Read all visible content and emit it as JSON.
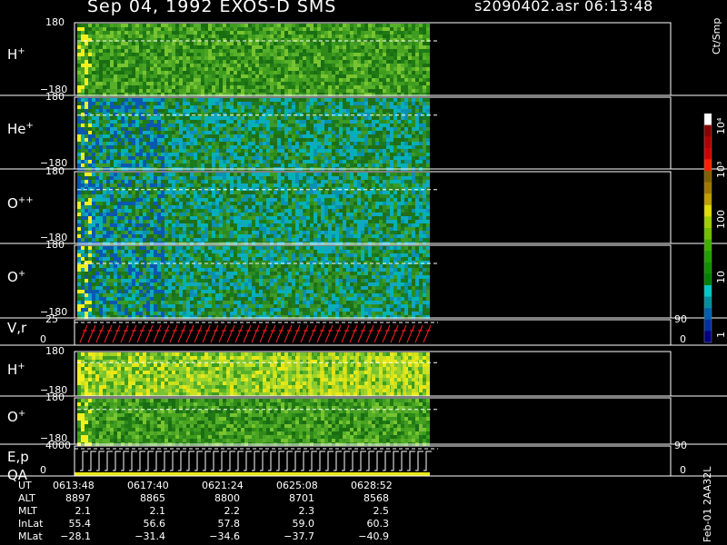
{
  "header": {
    "title": "Sep 04, 1992    EXOS-D SMS",
    "file_info": "s2090402.asr  06:13:48"
  },
  "panels": [
    {
      "id": "h-plus",
      "label": "H",
      "sup": "+",
      "ymax": "180",
      "ymin": "−180",
      "kind": "spectrogram",
      "palette": "green"
    },
    {
      "id": "he-plus",
      "label": "He",
      "sup": "+",
      "ymax": "180",
      "ymin": "−180",
      "kind": "spectrogram",
      "palette": "cyan"
    },
    {
      "id": "o-plusplus",
      "label": "O",
      "sup": "++",
      "ymax": "180",
      "ymin": "−180",
      "kind": "spectrogram",
      "palette": "cyan"
    },
    {
      "id": "o-plus",
      "label": "O",
      "sup": "+",
      "ymax": "180",
      "ymin": "−180",
      "kind": "spectrogram",
      "palette": "cyan"
    },
    {
      "id": "vr",
      "label": "V,r",
      "sup": "",
      "ymax": "25",
      "ymin": "0",
      "rtop": "90",
      "rbot": "0",
      "kind": "sawtooth",
      "color": "#ff2020"
    },
    {
      "id": "h-plus-2",
      "label": "H",
      "sup": "+",
      "ymax": "180",
      "ymin": "−180",
      "kind": "spectrogram",
      "palette": "bright"
    },
    {
      "id": "o-plus-2",
      "label": "O",
      "sup": "+",
      "ymax": "180",
      "ymin": "−180",
      "kind": "spectrogram",
      "palette": "green"
    },
    {
      "id": "ep",
      "label": "E,p",
      "label2": "QA",
      "sup": "",
      "ymax": "4000",
      "ymin": "0",
      "rtop": "90",
      "rbot": "0",
      "kind": "sawtooth",
      "color": "#ffffff"
    }
  ],
  "colorbar": {
    "unit": "Ct/Smp",
    "labels": [
      "10⁴",
      "10³",
      "100",
      "10",
      "1"
    ],
    "colors": [
      "#ffffff",
      "#8b0000",
      "#b00000",
      "#d00000",
      "#ff2000",
      "#806000",
      "#a07800",
      "#c0a000",
      "#e0e000",
      "#a0d000",
      "#70c000",
      "#40b000",
      "#20a000",
      "#109000",
      "#008000",
      "#00c8c8",
      "#0090a0",
      "#0060b0",
      "#0030a0",
      "#000080"
    ]
  },
  "ephemeris": {
    "row_labels": [
      "UT",
      "ALT",
      "MLT",
      "InLat",
      "MLat"
    ],
    "columns": [
      [
        "0613:48",
        "8897",
        "2.1",
        "55.4",
        "−28.1"
      ],
      [
        "0617:40",
        "8865",
        "2.1",
        "56.6",
        "−31.4"
      ],
      [
        "0621:24",
        "8800",
        "2.2",
        "57.8",
        "−34.6"
      ],
      [
        "0625:08",
        "8701",
        "2.3",
        "59.0",
        "−37.7"
      ],
      [
        "0628:52",
        "8568",
        "2.5",
        "60.3",
        "−40.9"
      ]
    ]
  },
  "footer": "Feb-01 2AA32L"
}
